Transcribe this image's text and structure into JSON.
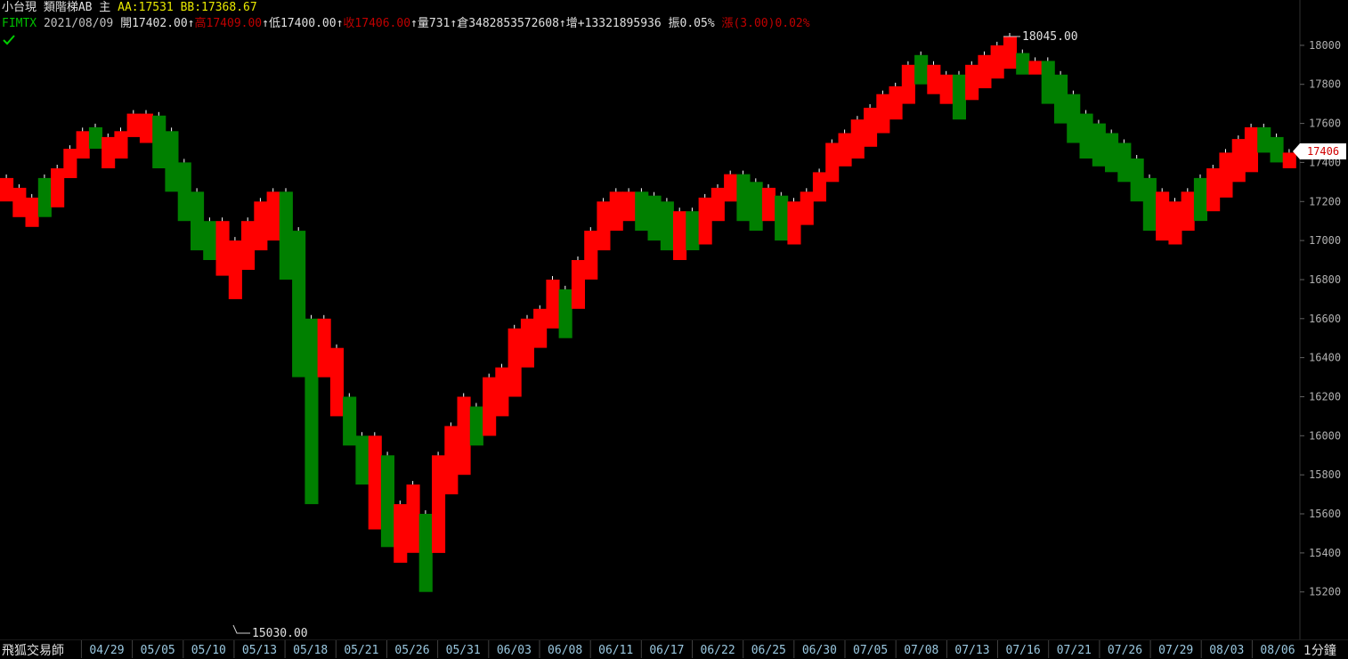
{
  "header": {
    "line1": [
      {
        "text": "小台現 類階梯AB   主 ",
        "color": "#e0e0e0"
      },
      {
        "text": "AA:17531 BB:17368.67",
        "color": "#e8e800"
      }
    ],
    "line2": [
      {
        "text": "FIMTX ",
        "color": "#00c000"
      },
      {
        "text": "2021/08/09 ",
        "color": "#c0c0c0"
      },
      {
        "text": "開17402.00↑",
        "color": "#e0e0e0"
      },
      {
        "text": "高17409.00",
        "color": "#c00000"
      },
      {
        "text": "↑",
        "color": "#e0e0e0"
      },
      {
        "text": "低17400.00↑",
        "color": "#e0e0e0"
      },
      {
        "text": "收17406.00",
        "color": "#c00000"
      },
      {
        "text": "↑",
        "color": "#e0e0e0"
      },
      {
        "text": "量731↑",
        "color": "#e0e0e0"
      },
      {
        "text": "倉3482853572608↑",
        "color": "#e0e0e0"
      },
      {
        "text": "增+13321895936 ",
        "color": "#e0e0e0"
      },
      {
        "text": "振0.05% ",
        "color": "#e0e0e0"
      },
      {
        "text": "漲(3.00)0.02%",
        "color": "#c00000"
      }
    ]
  },
  "status_icon": "check-icon",
  "footer": {
    "brand": "飛狐交易師",
    "unit": "1分鐘"
  },
  "colors": {
    "up": "#ff0000",
    "down": "#008000",
    "axis_text": "#b0b0b0",
    "annotation": "#e0e0e0"
  },
  "chart_data": {
    "type": "step-block",
    "ylim": [
      15030,
      18150
    ],
    "y_ticks": [
      15200,
      15400,
      15600,
      15800,
      16000,
      16200,
      16400,
      16600,
      16800,
      17000,
      17200,
      17400,
      17600,
      17800,
      18000
    ],
    "x_ticks": [
      "04/29",
      "05/05",
      "05/10",
      "05/13",
      "05/18",
      "05/21",
      "05/26",
      "05/31",
      "06/03",
      "06/08",
      "06/11",
      "06/17",
      "06/22",
      "06/25",
      "06/30",
      "07/05",
      "07/08",
      "07/13",
      "07/16",
      "07/21",
      "07/26",
      "07/29",
      "08/03",
      "08/06"
    ],
    "blocks": [
      {
        "lo": 17200,
        "hi": 17320,
        "dir": "up"
      },
      {
        "lo": 17120,
        "hi": 17270,
        "dir": "up"
      },
      {
        "lo": 17070,
        "hi": 17220,
        "dir": "up"
      },
      {
        "lo": 17120,
        "hi": 17320,
        "dir": "down"
      },
      {
        "lo": 17170,
        "hi": 17370,
        "dir": "up"
      },
      {
        "lo": 17320,
        "hi": 17470,
        "dir": "up"
      },
      {
        "lo": 17420,
        "hi": 17560,
        "dir": "up"
      },
      {
        "lo": 17470,
        "hi": 17580,
        "dir": "down"
      },
      {
        "lo": 17370,
        "hi": 17530,
        "dir": "up"
      },
      {
        "lo": 17420,
        "hi": 17560,
        "dir": "up"
      },
      {
        "lo": 17530,
        "hi": 17650,
        "dir": "up"
      },
      {
        "lo": 17500,
        "hi": 17650,
        "dir": "up"
      },
      {
        "lo": 17370,
        "hi": 17640,
        "dir": "down"
      },
      {
        "lo": 17250,
        "hi": 17560,
        "dir": "down"
      },
      {
        "lo": 17100,
        "hi": 17400,
        "dir": "down"
      },
      {
        "lo": 16950,
        "hi": 17250,
        "dir": "down"
      },
      {
        "lo": 16900,
        "hi": 17100,
        "dir": "down"
      },
      {
        "lo": 16820,
        "hi": 17100,
        "dir": "up"
      },
      {
        "lo": 16700,
        "hi": 17000,
        "dir": "up"
      },
      {
        "lo": 16850,
        "hi": 17100,
        "dir": "up"
      },
      {
        "lo": 16950,
        "hi": 17200,
        "dir": "up"
      },
      {
        "lo": 17000,
        "hi": 17250,
        "dir": "up"
      },
      {
        "lo": 16800,
        "hi": 17250,
        "dir": "down"
      },
      {
        "lo": 16300,
        "hi": 17050,
        "dir": "down"
      },
      {
        "lo": 15650,
        "hi": 16600,
        "dir": "down"
      },
      {
        "lo": 16300,
        "hi": 16600,
        "dir": "up"
      },
      {
        "lo": 16100,
        "hi": 16450,
        "dir": "up"
      },
      {
        "lo": 15950,
        "hi": 16200,
        "dir": "down"
      },
      {
        "lo": 15750,
        "hi": 16000,
        "dir": "down"
      },
      {
        "lo": 15520,
        "hi": 16000,
        "dir": "up"
      },
      {
        "lo": 15430,
        "hi": 15900,
        "dir": "down"
      },
      {
        "lo": 15350,
        "hi": 15650,
        "dir": "up"
      },
      {
        "lo": 15400,
        "hi": 15750,
        "dir": "up"
      },
      {
        "lo": 15200,
        "hi": 15600,
        "dir": "down"
      },
      {
        "lo": 15400,
        "hi": 15900,
        "dir": "up"
      },
      {
        "lo": 15700,
        "hi": 16050,
        "dir": "up"
      },
      {
        "lo": 15800,
        "hi": 16200,
        "dir": "up"
      },
      {
        "lo": 15950,
        "hi": 16150,
        "dir": "down"
      },
      {
        "lo": 16000,
        "hi": 16300,
        "dir": "up"
      },
      {
        "lo": 16100,
        "hi": 16350,
        "dir": "up"
      },
      {
        "lo": 16200,
        "hi": 16550,
        "dir": "up"
      },
      {
        "lo": 16350,
        "hi": 16600,
        "dir": "up"
      },
      {
        "lo": 16450,
        "hi": 16650,
        "dir": "up"
      },
      {
        "lo": 16550,
        "hi": 16800,
        "dir": "up"
      },
      {
        "lo": 16500,
        "hi": 16750,
        "dir": "down"
      },
      {
        "lo": 16650,
        "hi": 16900,
        "dir": "up"
      },
      {
        "lo": 16800,
        "hi": 17050,
        "dir": "up"
      },
      {
        "lo": 16950,
        "hi": 17200,
        "dir": "up"
      },
      {
        "lo": 17050,
        "hi": 17250,
        "dir": "up"
      },
      {
        "lo": 17100,
        "hi": 17250,
        "dir": "up"
      },
      {
        "lo": 17050,
        "hi": 17250,
        "dir": "down"
      },
      {
        "lo": 17000,
        "hi": 17230,
        "dir": "down"
      },
      {
        "lo": 16950,
        "hi": 17200,
        "dir": "down"
      },
      {
        "lo": 16900,
        "hi": 17150,
        "dir": "up"
      },
      {
        "lo": 16950,
        "hi": 17150,
        "dir": "down"
      },
      {
        "lo": 16980,
        "hi": 17220,
        "dir": "up"
      },
      {
        "lo": 17100,
        "hi": 17270,
        "dir": "up"
      },
      {
        "lo": 17200,
        "hi": 17340,
        "dir": "up"
      },
      {
        "lo": 17100,
        "hi": 17340,
        "dir": "down"
      },
      {
        "lo": 17050,
        "hi": 17300,
        "dir": "down"
      },
      {
        "lo": 17100,
        "hi": 17270,
        "dir": "up"
      },
      {
        "lo": 17000,
        "hi": 17230,
        "dir": "down"
      },
      {
        "lo": 16980,
        "hi": 17200,
        "dir": "up"
      },
      {
        "lo": 17080,
        "hi": 17250,
        "dir": "up"
      },
      {
        "lo": 17200,
        "hi": 17350,
        "dir": "up"
      },
      {
        "lo": 17300,
        "hi": 17500,
        "dir": "up"
      },
      {
        "lo": 17380,
        "hi": 17550,
        "dir": "up"
      },
      {
        "lo": 17420,
        "hi": 17620,
        "dir": "up"
      },
      {
        "lo": 17480,
        "hi": 17680,
        "dir": "up"
      },
      {
        "lo": 17550,
        "hi": 17750,
        "dir": "up"
      },
      {
        "lo": 17620,
        "hi": 17790,
        "dir": "up"
      },
      {
        "lo": 17700,
        "hi": 17900,
        "dir": "up"
      },
      {
        "lo": 17800,
        "hi": 17950,
        "dir": "down"
      },
      {
        "lo": 17750,
        "hi": 17900,
        "dir": "up"
      },
      {
        "lo": 17700,
        "hi": 17850,
        "dir": "up"
      },
      {
        "lo": 17620,
        "hi": 17850,
        "dir": "down"
      },
      {
        "lo": 17720,
        "hi": 17900,
        "dir": "up"
      },
      {
        "lo": 17780,
        "hi": 17950,
        "dir": "up"
      },
      {
        "lo": 17830,
        "hi": 18000,
        "dir": "up"
      },
      {
        "lo": 17880,
        "hi": 18045,
        "dir": "up"
      },
      {
        "lo": 17850,
        "hi": 17960,
        "dir": "down"
      },
      {
        "lo": 17850,
        "hi": 17920,
        "dir": "up"
      },
      {
        "lo": 17700,
        "hi": 17920,
        "dir": "down"
      },
      {
        "lo": 17600,
        "hi": 17850,
        "dir": "down"
      },
      {
        "lo": 17500,
        "hi": 17750,
        "dir": "down"
      },
      {
        "lo": 17420,
        "hi": 17650,
        "dir": "down"
      },
      {
        "lo": 17380,
        "hi": 17600,
        "dir": "down"
      },
      {
        "lo": 17350,
        "hi": 17550,
        "dir": "down"
      },
      {
        "lo": 17300,
        "hi": 17500,
        "dir": "down"
      },
      {
        "lo": 17200,
        "hi": 17420,
        "dir": "down"
      },
      {
        "lo": 17050,
        "hi": 17320,
        "dir": "down"
      },
      {
        "lo": 17000,
        "hi": 17250,
        "dir": "up"
      },
      {
        "lo": 16980,
        "hi": 17200,
        "dir": "up"
      },
      {
        "lo": 17050,
        "hi": 17250,
        "dir": "up"
      },
      {
        "lo": 17100,
        "hi": 17320,
        "dir": "down"
      },
      {
        "lo": 17150,
        "hi": 17370,
        "dir": "up"
      },
      {
        "lo": 17220,
        "hi": 17450,
        "dir": "up"
      },
      {
        "lo": 17300,
        "hi": 17520,
        "dir": "up"
      },
      {
        "lo": 17350,
        "hi": 17580,
        "dir": "up"
      },
      {
        "lo": 17450,
        "hi": 17580,
        "dir": "down"
      },
      {
        "lo": 17400,
        "hi": 17530,
        "dir": "down"
      },
      {
        "lo": 17370,
        "hi": 17450,
        "dir": "up"
      }
    ],
    "annotations": [
      {
        "label": "18045.00",
        "value": 18045
      },
      {
        "label": "15030.00",
        "value": 15030
      }
    ],
    "last_price": "17406"
  }
}
